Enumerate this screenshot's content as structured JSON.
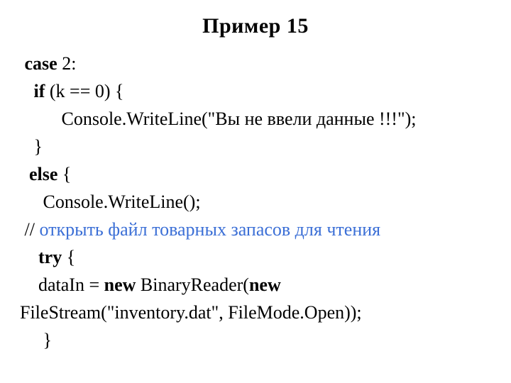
{
  "title": "Пример 15",
  "code": {
    "l1_pre": " ",
    "l1_kw": "case",
    "l1_post": " 2:",
    "l2_pre": "   ",
    "l2_kw": "if",
    "l2_post": " (k == 0) {",
    "l3": "         Console.WriteLine(\"Вы не ввели данные !!!\");",
    "l4": "   }",
    "l5_pre": "  ",
    "l5_kw": "else",
    "l5_post": " {",
    "l6": "     Console.WriteLine();",
    "l7_pre": " // ",
    "l7_comment": "открыть файл товарных запасов для чтения",
    "l8_pre": "    ",
    "l8_kw": "try",
    "l8_post": " {",
    "l9_pre": "    dataIn = ",
    "l9_kw1": "new",
    "l9_mid": " BinaryReader(",
    "l9_kw2": "new",
    "l10": "FileStream(\"inventory.dat\", FileMode.Open));",
    "l11": "     }"
  }
}
